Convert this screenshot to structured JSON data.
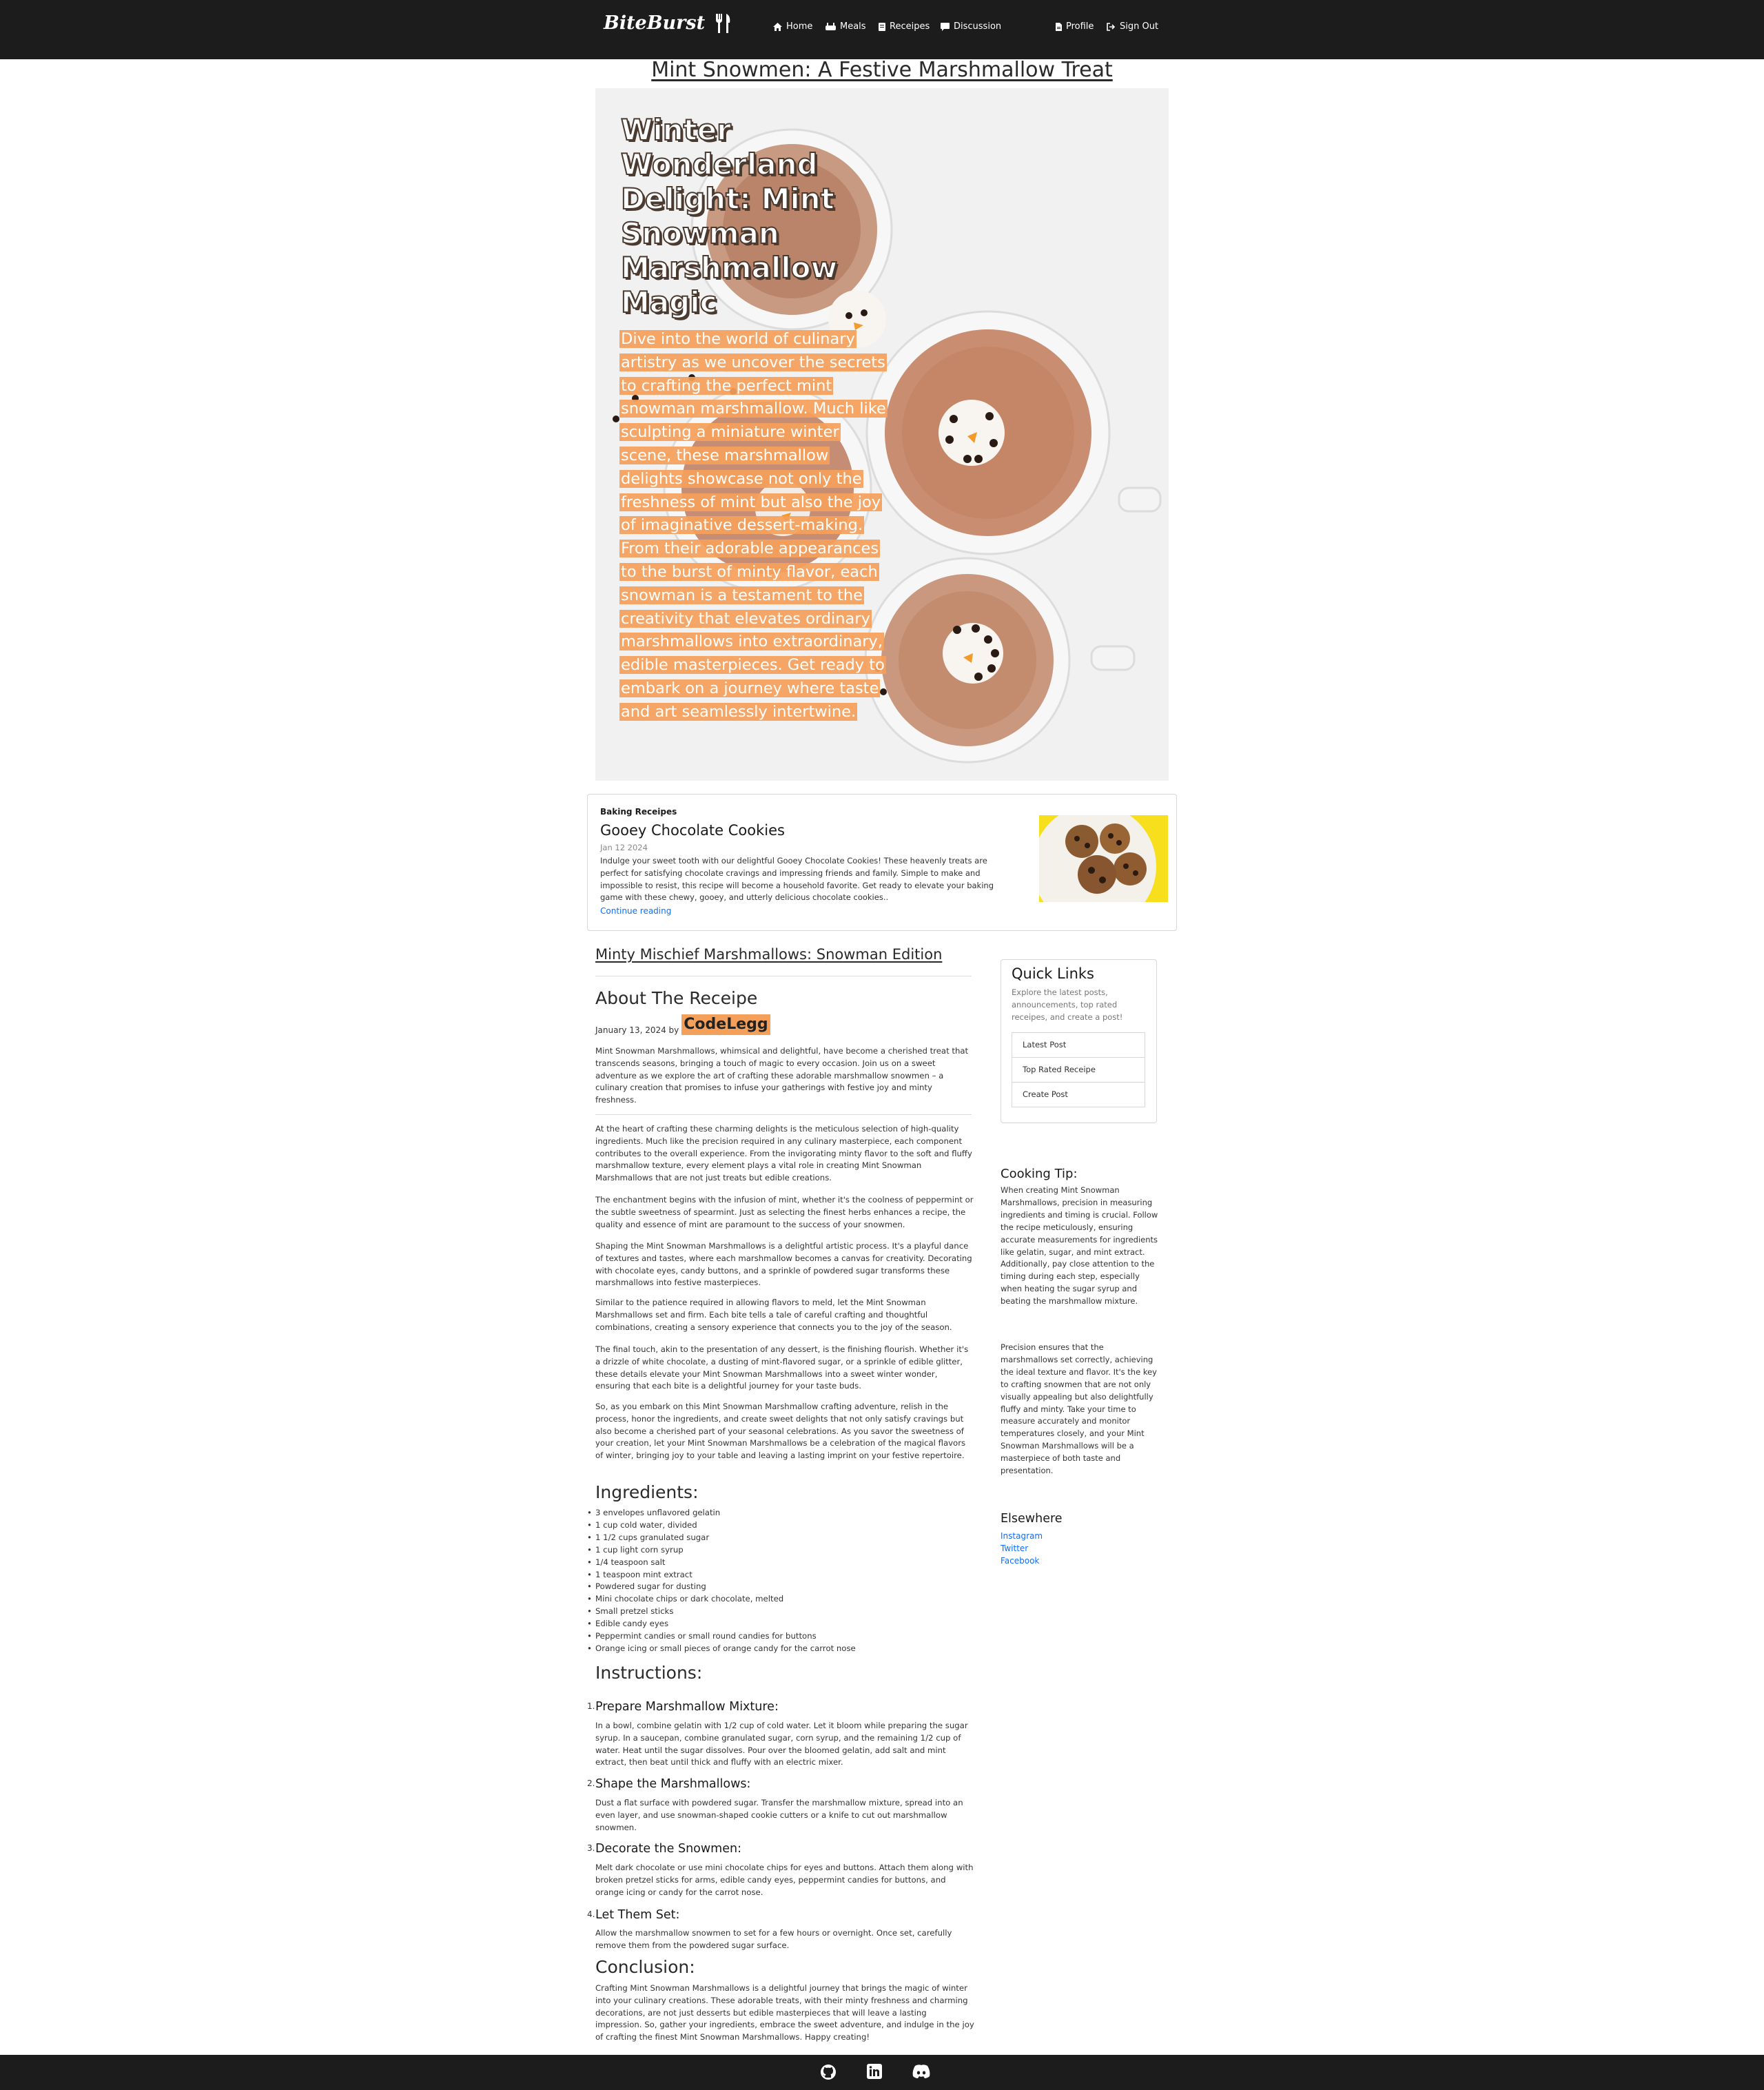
{
  "nav": {
    "brand": "BiteBurst",
    "home": "Home",
    "meals": "Meals",
    "receipes": "Receipes",
    "discussion": "Discussion",
    "profile": "Profile",
    "signout": "Sign Out"
  },
  "page_title": "Mint Snowmen: A Festive Marshmallow Treat",
  "hero": {
    "title": "Winter Wonderland Delight: Mint Snowman Marshmallow Magic",
    "text": "Dive into the world of culinary artistry as we uncover the secrets to crafting the perfect mint snowman marshmallow. Much like sculpting a miniature winter scene, these marshmallow delights showcase not only the freshness of mint but also the joy of imaginative dessert-making. From their adorable appearances to the burst of minty flavor, each snowman is a testament to the creativity that elevates ordinary marshmallows into extraordinary, edible masterpieces. Get ready to embark on a journey where taste and art seamlessly intertwine."
  },
  "featured": {
    "category": "Baking Receipes",
    "title": "Gooey Chocolate Cookies",
    "date": "Jan 12 2024",
    "text": "Indulge your sweet tooth with our delightful Gooey Chocolate Cookies! These heavenly treats are perfect for satisfying chocolate cravings and impressing friends and family. Simple to make and impossible to resist, this recipe will become a household favorite. Get ready to elevate your baking game with these chewy, gooey, and utterly delicious chocolate cookies..",
    "link": "Continue reading"
  },
  "article": {
    "subtitle": "Minty Mischief Marshmallows: Snowman Edition",
    "about_heading": "About The Receipe",
    "date": "January 13, 2024 by",
    "author": "CodeLegg",
    "intro": "Mint Snowman Marshmallows, whimsical and delightful, have become a cherished treat that transcends seasons, bringing a touch of magic to every occasion. Join us on a sweet adventure as we explore the art of crafting these adorable marshmallow snowmen – a culinary creation that promises to infuse your gatherings with festive joy and minty freshness.",
    "paragraphs": [
      "At the heart of crafting these charming delights is the meticulous selection of high-quality ingredients. Much like the precision required in any culinary masterpiece, each component contributes to the overall experience. From the invigorating minty flavor to the soft and fluffy marshmallow texture, every element plays a vital role in creating Mint Snowman Marshmallows that are not just treats but edible creations.",
      "The enchantment begins with the infusion of mint, whether it's the coolness of peppermint or the subtle sweetness of spearmint. Just as selecting the finest herbs enhances a recipe, the quality and essence of mint are paramount to the success of your snowmen.",
      "Shaping the Mint Snowman Marshmallows is a delightful artistic process. It's a playful dance of textures and tastes, where each marshmallow becomes a canvas for creativity. Decorating with chocolate eyes, candy buttons, and a sprinkle of powdered sugar transforms these marshmallows into festive masterpieces.",
      "Similar to the patience required in allowing flavors to meld, let the Mint Snowman Marshmallows set and firm. Each bite tells a tale of careful crafting and thoughtful combinations, creating a sensory experience that connects you to the joy of the season.",
      "The final touch, akin to the presentation of any dessert, is the finishing flourish. Whether it's a drizzle of white chocolate, a dusting of mint-flavored sugar, or a sprinkle of edible glitter, these details elevate your Mint Snowman Marshmallows into a sweet winter wonder, ensuring that each bite is a delightful journey for your taste buds.",
      "So, as you embark on this Mint Snowman Marshmallow crafting adventure, relish in the process, honor the ingredients, and create sweet delights that not only satisfy cravings but also become a cherished part of your seasonal celebrations. As you savor the sweetness of your creation, let your Mint Snowman Marshmallows be a celebration of the magical flavors of winter, bringing joy to your table and leaving a lasting imprint on your festive repertoire."
    ],
    "ingredients_heading": "Ingredients:",
    "ingredients": [
      "3 envelopes unflavored gelatin",
      "1 cup cold water, divided",
      "1 1/2 cups granulated sugar",
      "1 cup light corn syrup",
      "1/4 teaspoon salt",
      "1 teaspoon mint extract",
      "Powdered sugar for dusting",
      "Mini chocolate chips or dark chocolate, melted",
      "Small pretzel sticks",
      "Edible candy eyes",
      "Peppermint candies or small round candies for buttons",
      "Orange icing or small pieces of orange candy for the carrot nose"
    ],
    "instructions_heading": "Instructions:",
    "steps": [
      {
        "num": "1.",
        "title": "Prepare Marshmallow Mixture:",
        "text": "In a bowl, combine gelatin with 1/2 cup of cold water. Let it bloom while preparing the sugar syrup. In a saucepan, combine granulated sugar, corn syrup, and the remaining 1/2 cup of water. Heat until the sugar dissolves. Pour over the bloomed gelatin, add salt and mint extract, then beat until thick and fluffy with an electric mixer."
      },
      {
        "num": "2.",
        "title": "Shape the Marshmallows:",
        "text": "Dust a flat surface with powdered sugar. Transfer the marshmallow mixture, spread into an even layer, and use snowman-shaped cookie cutters or a knife to cut out marshmallow snowmen."
      },
      {
        "num": "3.",
        "title": "Decorate the Snowmen:",
        "text": "Melt dark chocolate or use mini chocolate chips for eyes and buttons. Attach them along with broken pretzel sticks for arms, edible candy eyes, peppermint candies for buttons, and orange icing or candy for the carrot nose."
      },
      {
        "num": "4.",
        "title": "Let Them Set:",
        "text": "Allow the marshmallow snowmen to set for a few hours or overnight. Once set, carefully remove them from the powdered sugar surface."
      }
    ],
    "conclusion_heading": "Conclusion:",
    "conclusion": "Crafting Mint Snowman Marshmallows is a delightful journey that brings the magic of winter into your culinary creations. These adorable treats, with their minty freshness and charming decorations, are not just desserts but edible masterpieces that will leave a lasting impression. So, gather your ingredients, embrace the sweet adventure, and indulge in the joy of crafting the finest Mint Snowman Marshmallows. Happy creating!"
  },
  "sidebar": {
    "quick_links_title": "Quick Links",
    "quick_links_desc": "Explore the latest posts, announcements, top rated receipes, and create a post!",
    "links": [
      "Latest Post",
      "Top Rated Receipe",
      "Create Post"
    ],
    "tip_heading": "Cooking Tip:",
    "tip_paragraphs": [
      "When creating Mint Snowman Marshmallows, precision in measuring ingredients and timing is crucial. Follow the recipe meticulously, ensuring accurate measurements for ingredients like gelatin, sugar, and mint extract. Additionally, pay close attention to the timing during each step, especially when heating the sugar syrup and beating the marshmallow mixture.",
      "Precision ensures that the marshmallows set correctly, achieving the ideal texture and flavor. It's the key to crafting snowmen that are not only visually appealing but also delightfully fluffy and minty. Take your time to measure accurately and monitor temperatures closely, and your Mint Snowman Marshmallows will be a masterpiece of both taste and presentation."
    ],
    "elsewhere_heading": "Elsewhere",
    "elsewhere_links": [
      "Instagram",
      "Twitter",
      "Facebook"
    ]
  },
  "footer": {
    "icons": [
      "github-icon",
      "linkedin-icon",
      "discord-icon"
    ]
  },
  "colors": {
    "nav_bg": "#1c1c1c",
    "accent_orange": "#f5a05a",
    "link_blue": "#0d6efd"
  }
}
